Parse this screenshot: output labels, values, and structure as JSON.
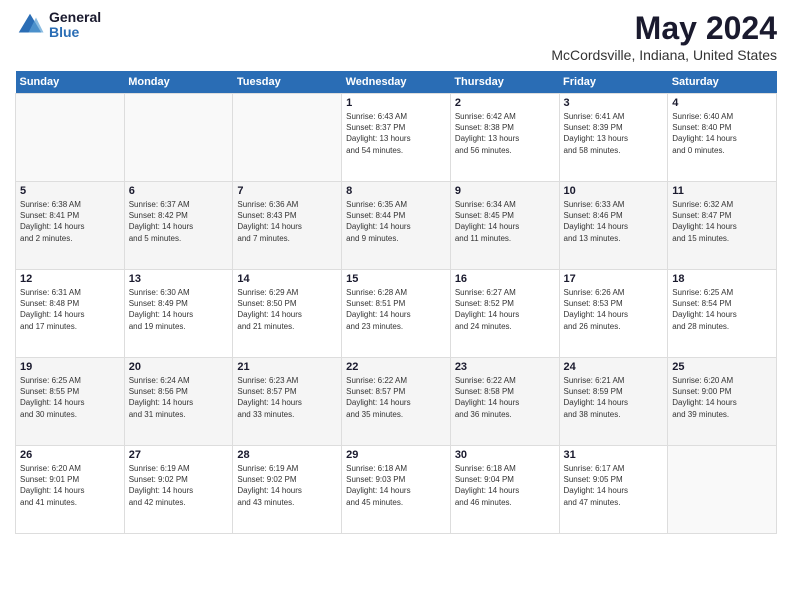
{
  "header": {
    "logo_general": "General",
    "logo_blue": "Blue",
    "month_year": "May 2024",
    "location": "McCordsville, Indiana, United States"
  },
  "days_of_week": [
    "Sunday",
    "Monday",
    "Tuesday",
    "Wednesday",
    "Thursday",
    "Friday",
    "Saturday"
  ],
  "weeks": [
    [
      {
        "day": "",
        "info": ""
      },
      {
        "day": "",
        "info": ""
      },
      {
        "day": "",
        "info": ""
      },
      {
        "day": "1",
        "info": "Sunrise: 6:43 AM\nSunset: 8:37 PM\nDaylight: 13 hours\nand 54 minutes."
      },
      {
        "day": "2",
        "info": "Sunrise: 6:42 AM\nSunset: 8:38 PM\nDaylight: 13 hours\nand 56 minutes."
      },
      {
        "day": "3",
        "info": "Sunrise: 6:41 AM\nSunset: 8:39 PM\nDaylight: 13 hours\nand 58 minutes."
      },
      {
        "day": "4",
        "info": "Sunrise: 6:40 AM\nSunset: 8:40 PM\nDaylight: 14 hours\nand 0 minutes."
      }
    ],
    [
      {
        "day": "5",
        "info": "Sunrise: 6:38 AM\nSunset: 8:41 PM\nDaylight: 14 hours\nand 2 minutes."
      },
      {
        "day": "6",
        "info": "Sunrise: 6:37 AM\nSunset: 8:42 PM\nDaylight: 14 hours\nand 5 minutes."
      },
      {
        "day": "7",
        "info": "Sunrise: 6:36 AM\nSunset: 8:43 PM\nDaylight: 14 hours\nand 7 minutes."
      },
      {
        "day": "8",
        "info": "Sunrise: 6:35 AM\nSunset: 8:44 PM\nDaylight: 14 hours\nand 9 minutes."
      },
      {
        "day": "9",
        "info": "Sunrise: 6:34 AM\nSunset: 8:45 PM\nDaylight: 14 hours\nand 11 minutes."
      },
      {
        "day": "10",
        "info": "Sunrise: 6:33 AM\nSunset: 8:46 PM\nDaylight: 14 hours\nand 13 minutes."
      },
      {
        "day": "11",
        "info": "Sunrise: 6:32 AM\nSunset: 8:47 PM\nDaylight: 14 hours\nand 15 minutes."
      }
    ],
    [
      {
        "day": "12",
        "info": "Sunrise: 6:31 AM\nSunset: 8:48 PM\nDaylight: 14 hours\nand 17 minutes."
      },
      {
        "day": "13",
        "info": "Sunrise: 6:30 AM\nSunset: 8:49 PM\nDaylight: 14 hours\nand 19 minutes."
      },
      {
        "day": "14",
        "info": "Sunrise: 6:29 AM\nSunset: 8:50 PM\nDaylight: 14 hours\nand 21 minutes."
      },
      {
        "day": "15",
        "info": "Sunrise: 6:28 AM\nSunset: 8:51 PM\nDaylight: 14 hours\nand 23 minutes."
      },
      {
        "day": "16",
        "info": "Sunrise: 6:27 AM\nSunset: 8:52 PM\nDaylight: 14 hours\nand 24 minutes."
      },
      {
        "day": "17",
        "info": "Sunrise: 6:26 AM\nSunset: 8:53 PM\nDaylight: 14 hours\nand 26 minutes."
      },
      {
        "day": "18",
        "info": "Sunrise: 6:25 AM\nSunset: 8:54 PM\nDaylight: 14 hours\nand 28 minutes."
      }
    ],
    [
      {
        "day": "19",
        "info": "Sunrise: 6:25 AM\nSunset: 8:55 PM\nDaylight: 14 hours\nand 30 minutes."
      },
      {
        "day": "20",
        "info": "Sunrise: 6:24 AM\nSunset: 8:56 PM\nDaylight: 14 hours\nand 31 minutes."
      },
      {
        "day": "21",
        "info": "Sunrise: 6:23 AM\nSunset: 8:57 PM\nDaylight: 14 hours\nand 33 minutes."
      },
      {
        "day": "22",
        "info": "Sunrise: 6:22 AM\nSunset: 8:57 PM\nDaylight: 14 hours\nand 35 minutes."
      },
      {
        "day": "23",
        "info": "Sunrise: 6:22 AM\nSunset: 8:58 PM\nDaylight: 14 hours\nand 36 minutes."
      },
      {
        "day": "24",
        "info": "Sunrise: 6:21 AM\nSunset: 8:59 PM\nDaylight: 14 hours\nand 38 minutes."
      },
      {
        "day": "25",
        "info": "Sunrise: 6:20 AM\nSunset: 9:00 PM\nDaylight: 14 hours\nand 39 minutes."
      }
    ],
    [
      {
        "day": "26",
        "info": "Sunrise: 6:20 AM\nSunset: 9:01 PM\nDaylight: 14 hours\nand 41 minutes."
      },
      {
        "day": "27",
        "info": "Sunrise: 6:19 AM\nSunset: 9:02 PM\nDaylight: 14 hours\nand 42 minutes."
      },
      {
        "day": "28",
        "info": "Sunrise: 6:19 AM\nSunset: 9:02 PM\nDaylight: 14 hours\nand 43 minutes."
      },
      {
        "day": "29",
        "info": "Sunrise: 6:18 AM\nSunset: 9:03 PM\nDaylight: 14 hours\nand 45 minutes."
      },
      {
        "day": "30",
        "info": "Sunrise: 6:18 AM\nSunset: 9:04 PM\nDaylight: 14 hours\nand 46 minutes."
      },
      {
        "day": "31",
        "info": "Sunrise: 6:17 AM\nSunset: 9:05 PM\nDaylight: 14 hours\nand 47 minutes."
      },
      {
        "day": "",
        "info": ""
      }
    ]
  ]
}
